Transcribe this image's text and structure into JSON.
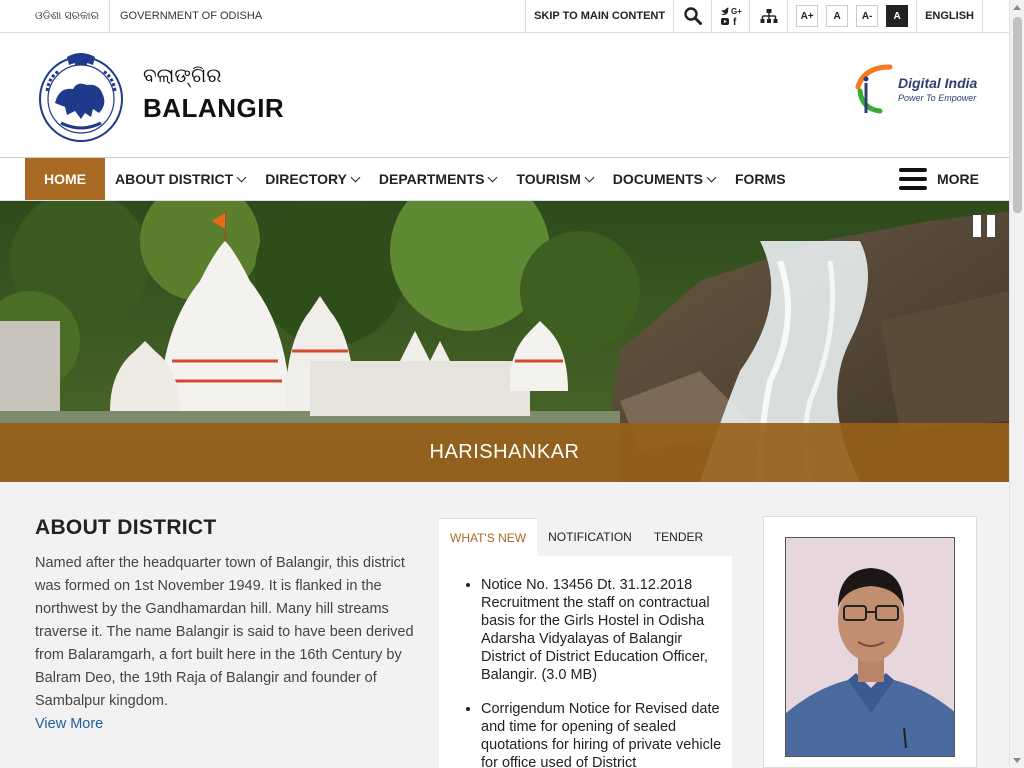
{
  "topbar": {
    "odia_gov": "ଓଡିଶା ସରକାର",
    "gov_label": "GOVERNMENT OF ODISHA",
    "skip_label": "SKIP TO MAIN CONTENT",
    "font_increase": "A+",
    "font_normal": "A",
    "font_decrease": "A-",
    "high_contrast": "A",
    "language": "ENGLISH",
    "icons": [
      "search-icon",
      "social-media-icon",
      "sitemap-icon"
    ]
  },
  "header": {
    "site_name_odia": "ବଲାଙ୍ଗିର",
    "site_name": "BALANGIR",
    "digital_india_title": "Digital India",
    "digital_india_tagline": "Power To Empower"
  },
  "nav": {
    "items": [
      {
        "label": "HOME",
        "active": true,
        "has_dropdown": false
      },
      {
        "label": "ABOUT DISTRICT",
        "has_dropdown": true
      },
      {
        "label": "DIRECTORY",
        "has_dropdown": true
      },
      {
        "label": "DEPARTMENTS",
        "has_dropdown": true
      },
      {
        "label": "TOURISM",
        "has_dropdown": true
      },
      {
        "label": "DOCUMENTS",
        "has_dropdown": true
      },
      {
        "label": "FORMS",
        "has_dropdown": false
      }
    ],
    "more_label": "MORE"
  },
  "banner": {
    "caption": "HARISHANKAR"
  },
  "about": {
    "heading": "ABOUT DISTRICT",
    "text": "Named after the headquarter town of Balangir, this district was formed on 1st November 1949. It is flanked in the northwest by the Gandhamardan hill. Many hill streams traverse it. The name Balangir is said to have been derived from Balaramgarh, a fort built here in the 16th Century by Balram Deo, the 19th Raja of Balangir and founder of Sambalpur kingdom.",
    "view_more": "View More"
  },
  "news": {
    "tabs": [
      {
        "label": "WHAT'S NEW",
        "active": true
      },
      {
        "label": "NOTIFICATION",
        "active": false
      },
      {
        "label": "TENDER",
        "active": false
      }
    ],
    "items": [
      "Notice No. 13456 Dt. 31.12.2018 Recruitment the staff on contractual basis for the Girls Hostel in Odisha Adarsha Vidyalayas of Balangir District of District Education Officer, Balangir. (3.0 MB)",
      "Corrigendum Notice for Revised date and time for opening of sealed quotations for hiring of private vehicle for office used of District"
    ]
  },
  "colors": {
    "accent": "#a96a23",
    "caption_bg": "#965f19",
    "link": "#1e5f9e"
  }
}
